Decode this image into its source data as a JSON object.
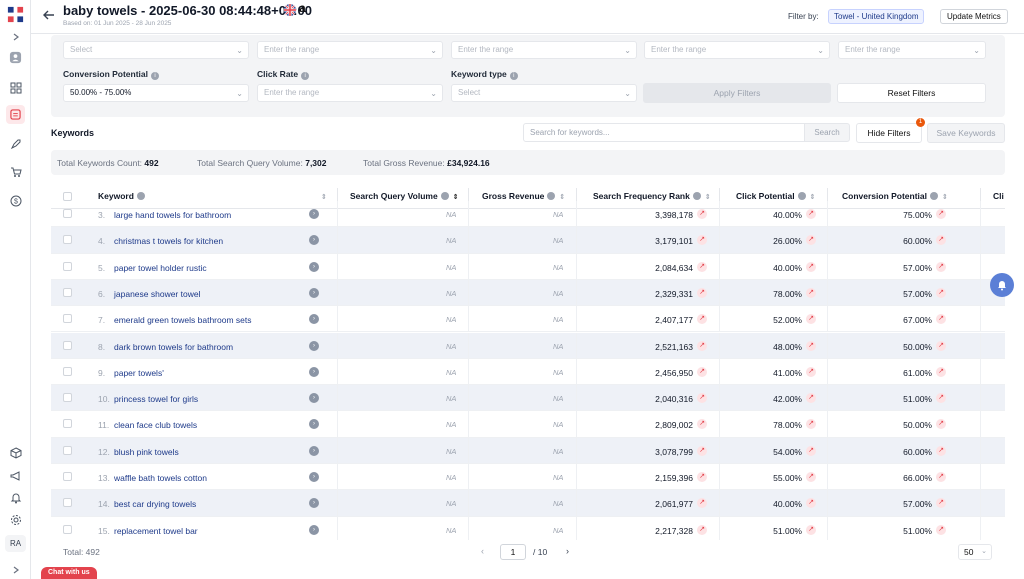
{
  "header": {
    "title": "baby towels - 2025-06-30 08:44:48+00:00",
    "subtitle": "Based on: 01 Jun 2025 - 28 Jun 2025",
    "marketplace_glyph": "a",
    "filter_by_label": "Filter by:",
    "filter_chip": "Towel - United Kingdom",
    "update_button": "Update Metrics"
  },
  "sidebar": {
    "avatar_initials": "RA",
    "icons": [
      "logo-icon",
      "expand-icon",
      "profile-icon",
      "dashboard-icon",
      "keywords-icon",
      "rocket-icon",
      "cart-icon",
      "dollar-icon",
      "box-icon",
      "megaphone-icon",
      "bell-icon",
      "gear-icon",
      "expand-icon"
    ]
  },
  "filters": {
    "top_row_placeholders": [
      "Select",
      "Enter the range",
      "Enter the range",
      "Enter the range",
      "Enter the range"
    ],
    "conversion_label": "Conversion Potential",
    "conversion_value": "50.00% - 75.00%",
    "click_rate_label": "Click Rate",
    "click_rate_placeholder": "Enter the range",
    "keyword_type_label": "Keyword type",
    "keyword_type_placeholder": "Select",
    "apply_button": "Apply Filters",
    "reset_button": "Reset Filters"
  },
  "keywords_bar": {
    "heading": "Keywords",
    "search_placeholder": "Search for keywords...",
    "search_button": "Search",
    "hide_filters_button": "Hide Filters",
    "hide_filters_badge": "1",
    "save_keywords_button": "Save Keywords"
  },
  "summary": {
    "count_label": "Total Keywords Count:",
    "count_value": "492",
    "volume_label": "Total Search Query Volume:",
    "volume_value": "7,302",
    "revenue_label": "Total Gross Revenue:",
    "revenue_value": "£34,924.16"
  },
  "table": {
    "columns": [
      "Keyword",
      "Search Query Volume",
      "Gross Revenue",
      "Search Frequency Rank",
      "Click Potential",
      "Conversion Potential",
      "Cli"
    ],
    "rows": [
      {
        "n": "3.",
        "keyword": "large hand towels for bathroom",
        "sqv": "NA",
        "rev": "NA",
        "sfr": "3,398,178",
        "click": "40.00%",
        "conv": "75.00%"
      },
      {
        "n": "4.",
        "keyword": "christmas t towels for kitchen",
        "sqv": "NA",
        "rev": "NA",
        "sfr": "3,179,101",
        "click": "26.00%",
        "conv": "60.00%"
      },
      {
        "n": "5.",
        "keyword": "paper towel holder rustic",
        "sqv": "NA",
        "rev": "NA",
        "sfr": "2,084,634",
        "click": "40.00%",
        "conv": "57.00%"
      },
      {
        "n": "6.",
        "keyword": "japanese shower towel",
        "sqv": "NA",
        "rev": "NA",
        "sfr": "2,329,331",
        "click": "78.00%",
        "conv": "57.00%"
      },
      {
        "n": "7.",
        "keyword": "emerald green towels bathroom sets",
        "sqv": "NA",
        "rev": "NA",
        "sfr": "2,407,177",
        "click": "52.00%",
        "conv": "67.00%"
      },
      {
        "n": "8.",
        "keyword": "dark brown towels for bathroom",
        "sqv": "NA",
        "rev": "NA",
        "sfr": "2,521,163",
        "click": "48.00%",
        "conv": "50.00%"
      },
      {
        "n": "9.",
        "keyword": "paper towels'",
        "sqv": "NA",
        "rev": "NA",
        "sfr": "2,456,950",
        "click": "41.00%",
        "conv": "61.00%"
      },
      {
        "n": "10.",
        "keyword": "princess towel for girls",
        "sqv": "NA",
        "rev": "NA",
        "sfr": "2,040,316",
        "click": "42.00%",
        "conv": "51.00%"
      },
      {
        "n": "11.",
        "keyword": "clean face club towels",
        "sqv": "NA",
        "rev": "NA",
        "sfr": "2,809,002",
        "click": "78.00%",
        "conv": "50.00%"
      },
      {
        "n": "12.",
        "keyword": "blush pink towels",
        "sqv": "NA",
        "rev": "NA",
        "sfr": "3,078,799",
        "click": "54.00%",
        "conv": "60.00%"
      },
      {
        "n": "13.",
        "keyword": "waffle bath towels cotton",
        "sqv": "NA",
        "rev": "NA",
        "sfr": "2,159,396",
        "click": "55.00%",
        "conv": "66.00%"
      },
      {
        "n": "14.",
        "keyword": "best car drying towels",
        "sqv": "NA",
        "rev": "NA",
        "sfr": "2,061,977",
        "click": "40.00%",
        "conv": "57.00%"
      },
      {
        "n": "15.",
        "keyword": "replacement towel bar",
        "sqv": "NA",
        "rev": "NA",
        "sfr": "2,217,328",
        "click": "51.00%",
        "conv": "51.00%"
      }
    ]
  },
  "footer": {
    "total": "Total: 492",
    "current_page": "1",
    "total_pages": "/ 10",
    "page_size": "50"
  },
  "chat_button": "Chat with us",
  "colors": {
    "accent": "#e3434d",
    "keyword_link": "#1e3a8a",
    "row_alt": "#eef1f7"
  }
}
